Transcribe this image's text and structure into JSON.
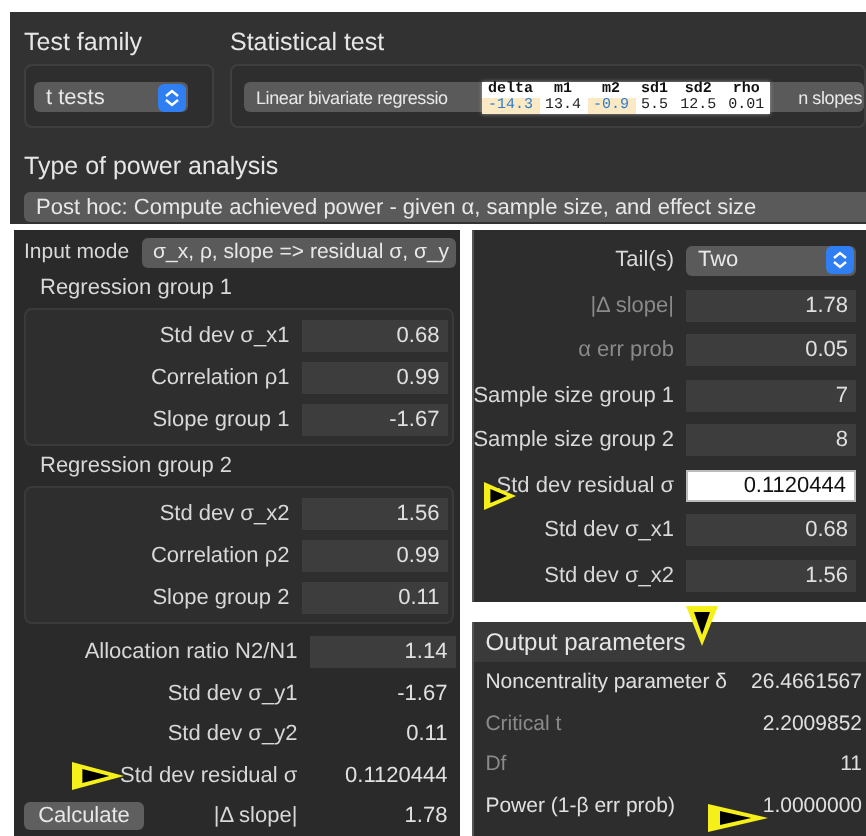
{
  "test_family": {
    "label": "Test family",
    "value": "t tests"
  },
  "statistical_test": {
    "label": "Statistical test",
    "value": "Linear bivariate regressio",
    "value_after_tooltip": "n slopes"
  },
  "data_table": {
    "columns": [
      "delta",
      "m1",
      "m2",
      "sd1",
      "sd2",
      "rho"
    ],
    "rows": [
      [
        {
          "text": "-14.3",
          "highlighted": true
        },
        {
          "text": "13.4",
          "highlighted": false
        },
        {
          "text": "-0.9",
          "highlighted": true
        },
        {
          "text": "5.5",
          "highlighted": false
        },
        {
          "text": "12.5",
          "highlighted": false
        },
        {
          "text": "0.01",
          "highlighted": false
        }
      ]
    ]
  },
  "power_analysis": {
    "label": "Type of power analysis",
    "value": "Post hoc: Compute achieved power - given α, sample size, and effect size"
  },
  "input_mode": {
    "label": "Input mode",
    "value": "σ_x, ρ, slope => residual σ, σ_y"
  },
  "groups": [
    {
      "title": "Regression group 1",
      "rows": [
        {
          "label": "Std dev σ_x1",
          "value": "0.68"
        },
        {
          "label": "Correlation ρ1",
          "value": "0.99"
        },
        {
          "label": "Slope group 1",
          "value": "-1.67"
        }
      ]
    },
    {
      "title": "Regression group 2",
      "rows": [
        {
          "label": "Std dev σ_x2",
          "value": "1.56"
        },
        {
          "label": "Correlation ρ2",
          "value": "0.99"
        },
        {
          "label": "Slope group 2",
          "value": "0.11"
        }
      ]
    }
  ],
  "derived": [
    {
      "label": "Allocation ratio N2/N1",
      "value": "1.14",
      "kind": "field"
    },
    {
      "label": "Std dev σ_y1",
      "value": "-1.67",
      "kind": "readout"
    },
    {
      "label": "Std dev σ_y2",
      "value": "0.11",
      "kind": "readout"
    },
    {
      "label": "Std dev residual σ",
      "value": "0.1120444",
      "kind": "readout"
    },
    {
      "label": "|Δ slope|",
      "value": "1.78",
      "kind": "readout"
    }
  ],
  "calculate_button": "Calculate",
  "input_parameters": [
    {
      "label": "Tail(s)",
      "value": "Two",
      "kind": "select",
      "dimmed": false,
      "focused": false
    },
    {
      "label": "|Δ slope|",
      "value": "1.78",
      "kind": "field",
      "dimmed": true,
      "focused": false
    },
    {
      "label": "α err prob",
      "value": "0.05",
      "kind": "field",
      "dimmed": true,
      "focused": false
    },
    {
      "label": "Sample size group 1",
      "value": "7",
      "kind": "field",
      "dimmed": false,
      "focused": false
    },
    {
      "label": "Sample size group 2",
      "value": "8",
      "kind": "field",
      "dimmed": false,
      "focused": false
    },
    {
      "label": "Std dev residual σ",
      "value": "0.1120444",
      "kind": "field",
      "dimmed": false,
      "focused": true
    },
    {
      "label": "Std dev σ_x1",
      "value": "0.68",
      "kind": "field",
      "dimmed": false,
      "focused": false
    },
    {
      "label": "Std dev σ_x2",
      "value": "1.56",
      "kind": "field",
      "dimmed": false,
      "focused": false
    }
  ],
  "output_parameters": {
    "title": "Output parameters",
    "rows": [
      {
        "label": "Noncentrality parameter δ",
        "value": "26.4661567",
        "dimmed": false
      },
      {
        "label": "Critical t",
        "value": "2.2009852",
        "dimmed": true
      },
      {
        "label": "Df",
        "value": "11",
        "dimmed": true
      },
      {
        "label": "Power (1-β err prob)",
        "value": "1.0000000",
        "dimmed": false
      }
    ]
  }
}
